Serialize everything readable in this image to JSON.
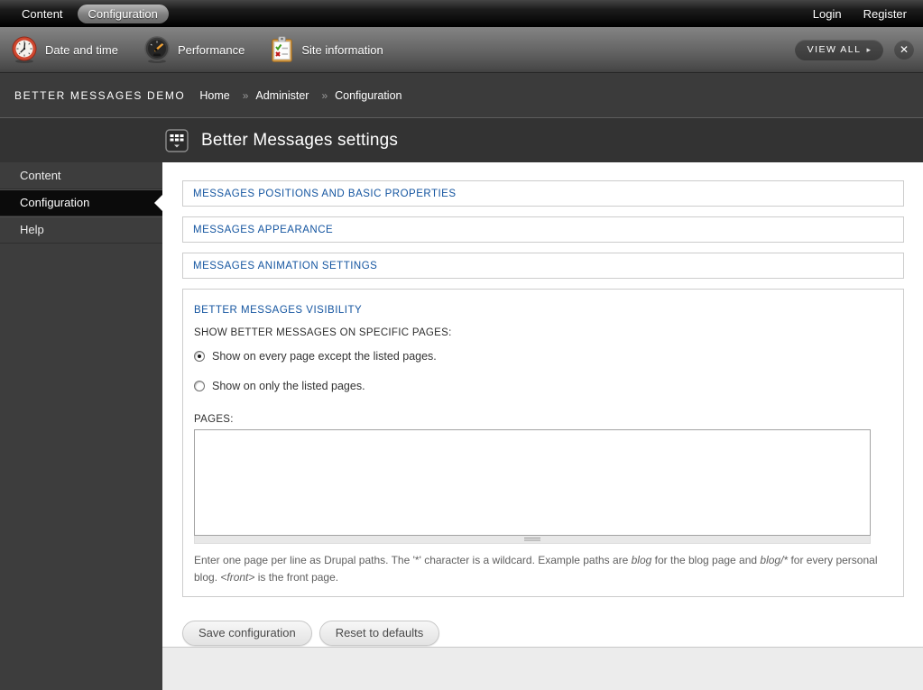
{
  "top_bar": {
    "tabs": [
      {
        "label": "Content",
        "active": false
      },
      {
        "label": "Configuration",
        "active": true
      }
    ],
    "account_links": {
      "login": "Login",
      "register": "Register"
    }
  },
  "shortcut_bar": {
    "items": [
      {
        "label": "Date and time",
        "icon": "clock-icon"
      },
      {
        "label": "Performance",
        "icon": "gauge-icon"
      },
      {
        "label": "Site information",
        "icon": "clipboard-icon"
      }
    ],
    "view_all_label": "VIEW ALL",
    "view_all_arrow": "▸",
    "close_glyph": "✕"
  },
  "breadcrumb": {
    "site_name": "BETTER MESSAGES DEMO",
    "home": "Home",
    "separator": "»",
    "items": [
      "Administer",
      "Configuration"
    ]
  },
  "page": {
    "title": "Better Messages settings"
  },
  "sidebar": {
    "items": [
      {
        "label": "Content",
        "active": false
      },
      {
        "label": "Configuration",
        "active": true
      },
      {
        "label": "Help",
        "active": false
      }
    ]
  },
  "fieldsets": {
    "collapsed": [
      "MESSAGES POSITIONS AND BASIC PROPERTIES",
      "MESSAGES APPEARANCE",
      "MESSAGES ANIMATION SETTINGS"
    ],
    "visibility": {
      "legend": "BETTER MESSAGES VISIBILITY",
      "group_label": "SHOW BETTER MESSAGES ON SPECIFIC PAGES:",
      "radios": [
        {
          "label": "Show on every page except the listed pages.",
          "selected": true
        },
        {
          "label": "Show on only the listed pages.",
          "selected": false
        }
      ],
      "selected_value": "Show on every page except the listed pages.",
      "pages_label": "PAGES:",
      "pages_value": "",
      "description": {
        "part1": "Enter one page per line as Drupal paths. The '*' character is a wildcard. Example paths are ",
        "em1": "blog",
        "part2": " for the blog page and ",
        "em2": "blog/*",
        "part3": " for every personal blog. ",
        "em3": "<front>",
        "part4": " is the front page."
      }
    }
  },
  "actions": {
    "save": "Save configuration",
    "reset": "Reset to defaults"
  },
  "colors": {
    "legend_link_blue": "#1455A0",
    "top_bar_black": "#000000",
    "shortcut_bar_gray": "#636363",
    "breadcrumb_bar": "#3B3B3B",
    "sidebar_bg": "#3D3D3D",
    "active_item_bg": "#0B0B0B",
    "content_bg": "#FFFFFF",
    "footer_bg": "#ECECEC"
  }
}
